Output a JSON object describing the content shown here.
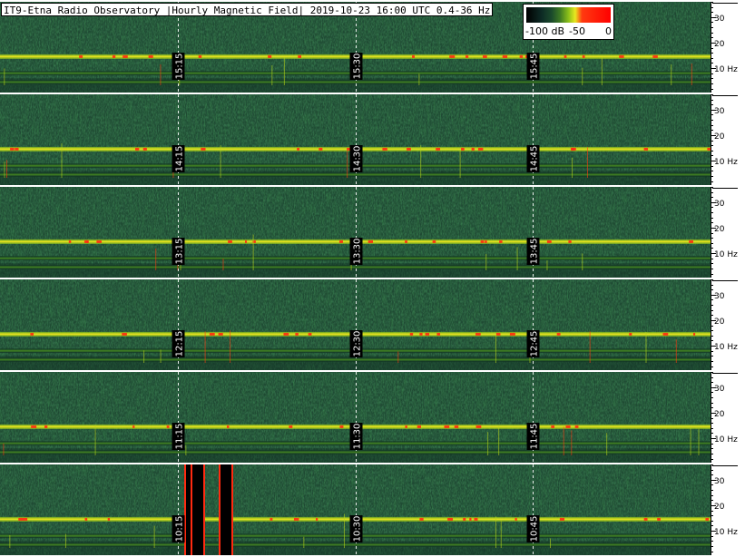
{
  "title": "IT9-Etna Radio Observatory |Hourly Magnetic Field| 2019-10-23 16:00 UTC 0.4-36 Hz",
  "colorscale": {
    "labels": [
      "-100 dB",
      "-50",
      "0"
    ],
    "colors": [
      "#000000",
      "#1b4a2c",
      "#3e7a23",
      "#8bbf1a",
      "#e8e820",
      "#ff3a10",
      "#ff0000"
    ]
  },
  "chart_data": {
    "type": "heatmap",
    "description_kind": "spectrogram",
    "rows": [
      {
        "hour_label": "15",
        "time_ticks": [
          "15:15",
          "15:30",
          "15:45"
        ]
      },
      {
        "hour_label": "14",
        "time_ticks": [
          "14:15",
          "14:30",
          "14:45"
        ]
      },
      {
        "hour_label": "13",
        "time_ticks": [
          "13:15",
          "13:30",
          "13:45"
        ]
      },
      {
        "hour_label": "12",
        "time_ticks": [
          "12:15",
          "12:30",
          "12:45"
        ]
      },
      {
        "hour_label": "11",
        "time_ticks": [
          "11:15",
          "11:30",
          "11:45"
        ]
      },
      {
        "hour_label": "10",
        "time_ticks": [
          "10:15",
          "10:30",
          "10:45"
        ]
      }
    ],
    "frequency_ticks": [
      "30",
      "20",
      "10 Hz"
    ],
    "frequency_tick_values": [
      30,
      20,
      10
    ],
    "frequency_range_hz": [
      0.4,
      36
    ],
    "db_range": [
      -100,
      0
    ],
    "bands_hz": [
      14.5,
      8.0,
      4.5
    ],
    "band_strength_db": [
      -45,
      -60,
      -65
    ]
  }
}
